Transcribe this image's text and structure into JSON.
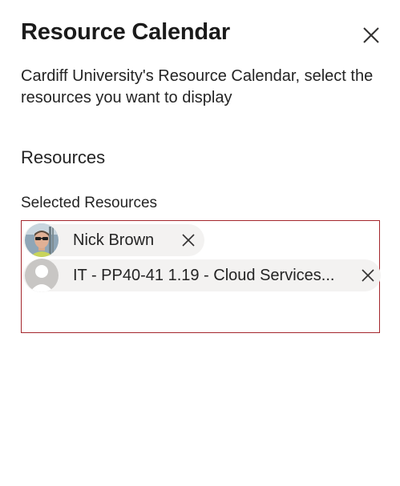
{
  "panel": {
    "title": "Resource Calendar",
    "description": "Cardiff University's Resource Calendar, select the resources you want to display",
    "section_heading": "Resources",
    "picker_label": "Selected Resources"
  },
  "selected_resources": [
    {
      "name": "Nick Brown",
      "avatar": "user-photo"
    },
    {
      "name": "IT - PP40-41 1.19 - Cloud Services...",
      "avatar": "default-person-icon"
    }
  ],
  "colors": {
    "picker_border": "#a4262c",
    "pill_background": "#f3f2f1"
  }
}
